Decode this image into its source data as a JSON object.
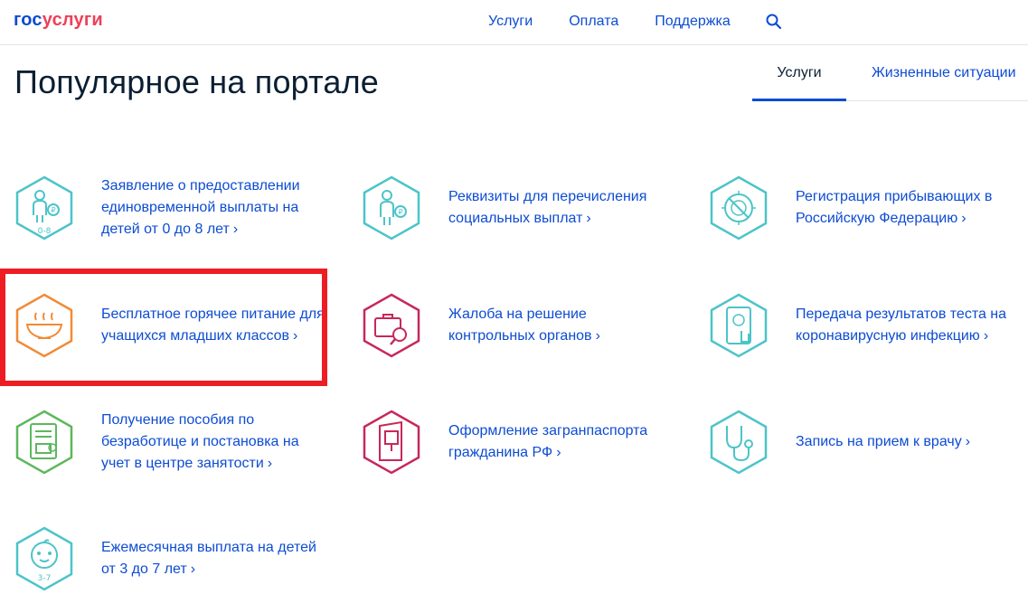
{
  "header": {
    "logo": {
      "part1": "гос",
      "part2": "услуги"
    },
    "nav": [
      "Услуги",
      "Оплата",
      "Поддержка"
    ],
    "search_icon": "search-icon"
  },
  "page": {
    "title": "Популярное на портале"
  },
  "tabs": [
    {
      "label": "Услуги",
      "active": true
    },
    {
      "label": "Жизненные ситуации",
      "active": false
    }
  ],
  "services": [
    {
      "label": "Заявление о предоставлении единовременной выплаты на детей от 0 до 8 лет",
      "icon": "child-payment-icon",
      "badge": "0-8",
      "color": "#4cc4c9"
    },
    {
      "label": "Реквизиты для перечисления социальных выплат",
      "icon": "social-payment-icon",
      "color": "#4cc4c9"
    },
    {
      "label": "Регистрация прибывающих в Российскую Федерацию",
      "icon": "virus-icon",
      "color": "#4cc4c9"
    },
    {
      "label": "Бесплатное горячее питание для учащихся младших классов",
      "icon": "hot-meal-icon",
      "color": "#f28a36"
    },
    {
      "label": "Жалоба на решение контрольных органов",
      "icon": "complaint-icon",
      "color": "#c7285a"
    },
    {
      "label": "Передача результатов теста на коронавирусную инфекцию",
      "icon": "covid-test-icon",
      "color": "#4cc4c9"
    },
    {
      "label": "Получение пособия по безработице и постановка на учет в центре занятости",
      "icon": "unemployment-icon",
      "color": "#5cb85c"
    },
    {
      "label": "Оформление загранпаспорта гражданина РФ",
      "icon": "passport-icon",
      "color": "#c7285a"
    },
    {
      "label": "Запись на прием к врачу",
      "icon": "stethoscope-icon",
      "color": "#4cc4c9"
    },
    {
      "label": "Ежемесячная выплата на детей от 3 до 7 лет",
      "icon": "baby-icon",
      "badge": "3-7",
      "color": "#4cc4c9"
    }
  ],
  "chevron": "›"
}
